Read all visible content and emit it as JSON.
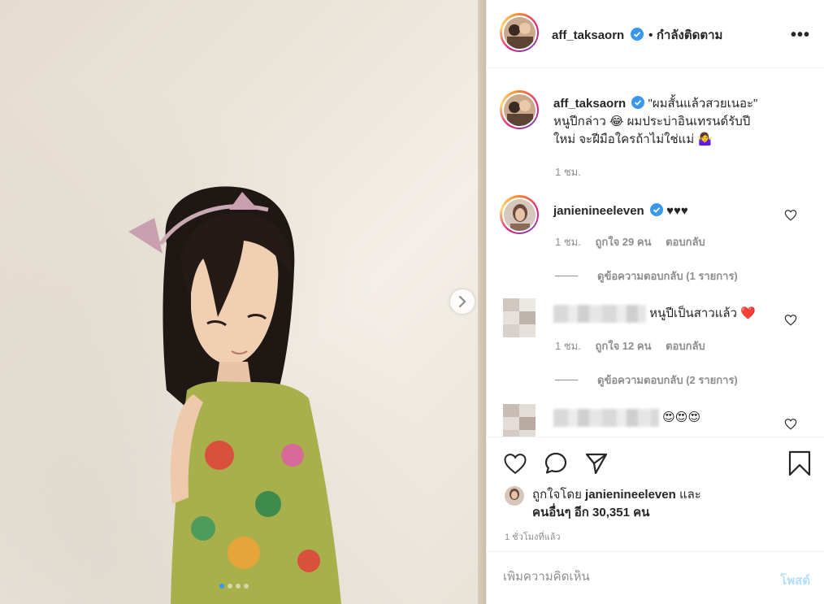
{
  "post": {
    "author": "aff_taksaorn",
    "follow_label": "กำลังติดตาม",
    "more_label": "•••",
    "caption_quote": "\"ผมสั้นแล้วสวยเนอะ\"",
    "caption_line2": "หนูปีกล่าว 😂 ผมประบ่าอินเทรนด์รับปี",
    "caption_line3": "ใหม่ จะฝีมือใครถ้าไม่ใช่แม่ 🤷‍♀️",
    "caption_time": "1 ชม."
  },
  "comments": [
    {
      "user": "janienineeleven",
      "text": "♥♥♥",
      "time": "1 ชม.",
      "likes": "ถูกใจ 29 คน",
      "reply": "ตอบกลับ",
      "view_replies": "ดูข้อความตอบกลับ (1 รายการ)"
    },
    {
      "user": "",
      "text": "หนูปีเป็นสาวแล้ว ❤️",
      "time": "1 ชม.",
      "likes": "ถูกใจ 12 คน",
      "reply": "ตอบกลับ",
      "view_replies": "ดูข้อความตอบกลับ (2 รายการ)"
    },
    {
      "user": "",
      "text": "😍😍😍"
    }
  ],
  "likes": {
    "prefix": "ถูกใจโดย",
    "user": "janienineeleven",
    "and": "และ",
    "others": "คนอื่นๆ อีก 30,351 คน"
  },
  "time_ago": "1 ชั่วโมงที่แล้ว",
  "add_comment": {
    "placeholder": "เพิ่มความคิดเห็น",
    "post_label": "โพสต์"
  },
  "colors": {
    "accent": "#3897f0",
    "post_disabled": "#b2dffc",
    "muted": "#8e8e8e",
    "heart_red": "#ed4956"
  }
}
